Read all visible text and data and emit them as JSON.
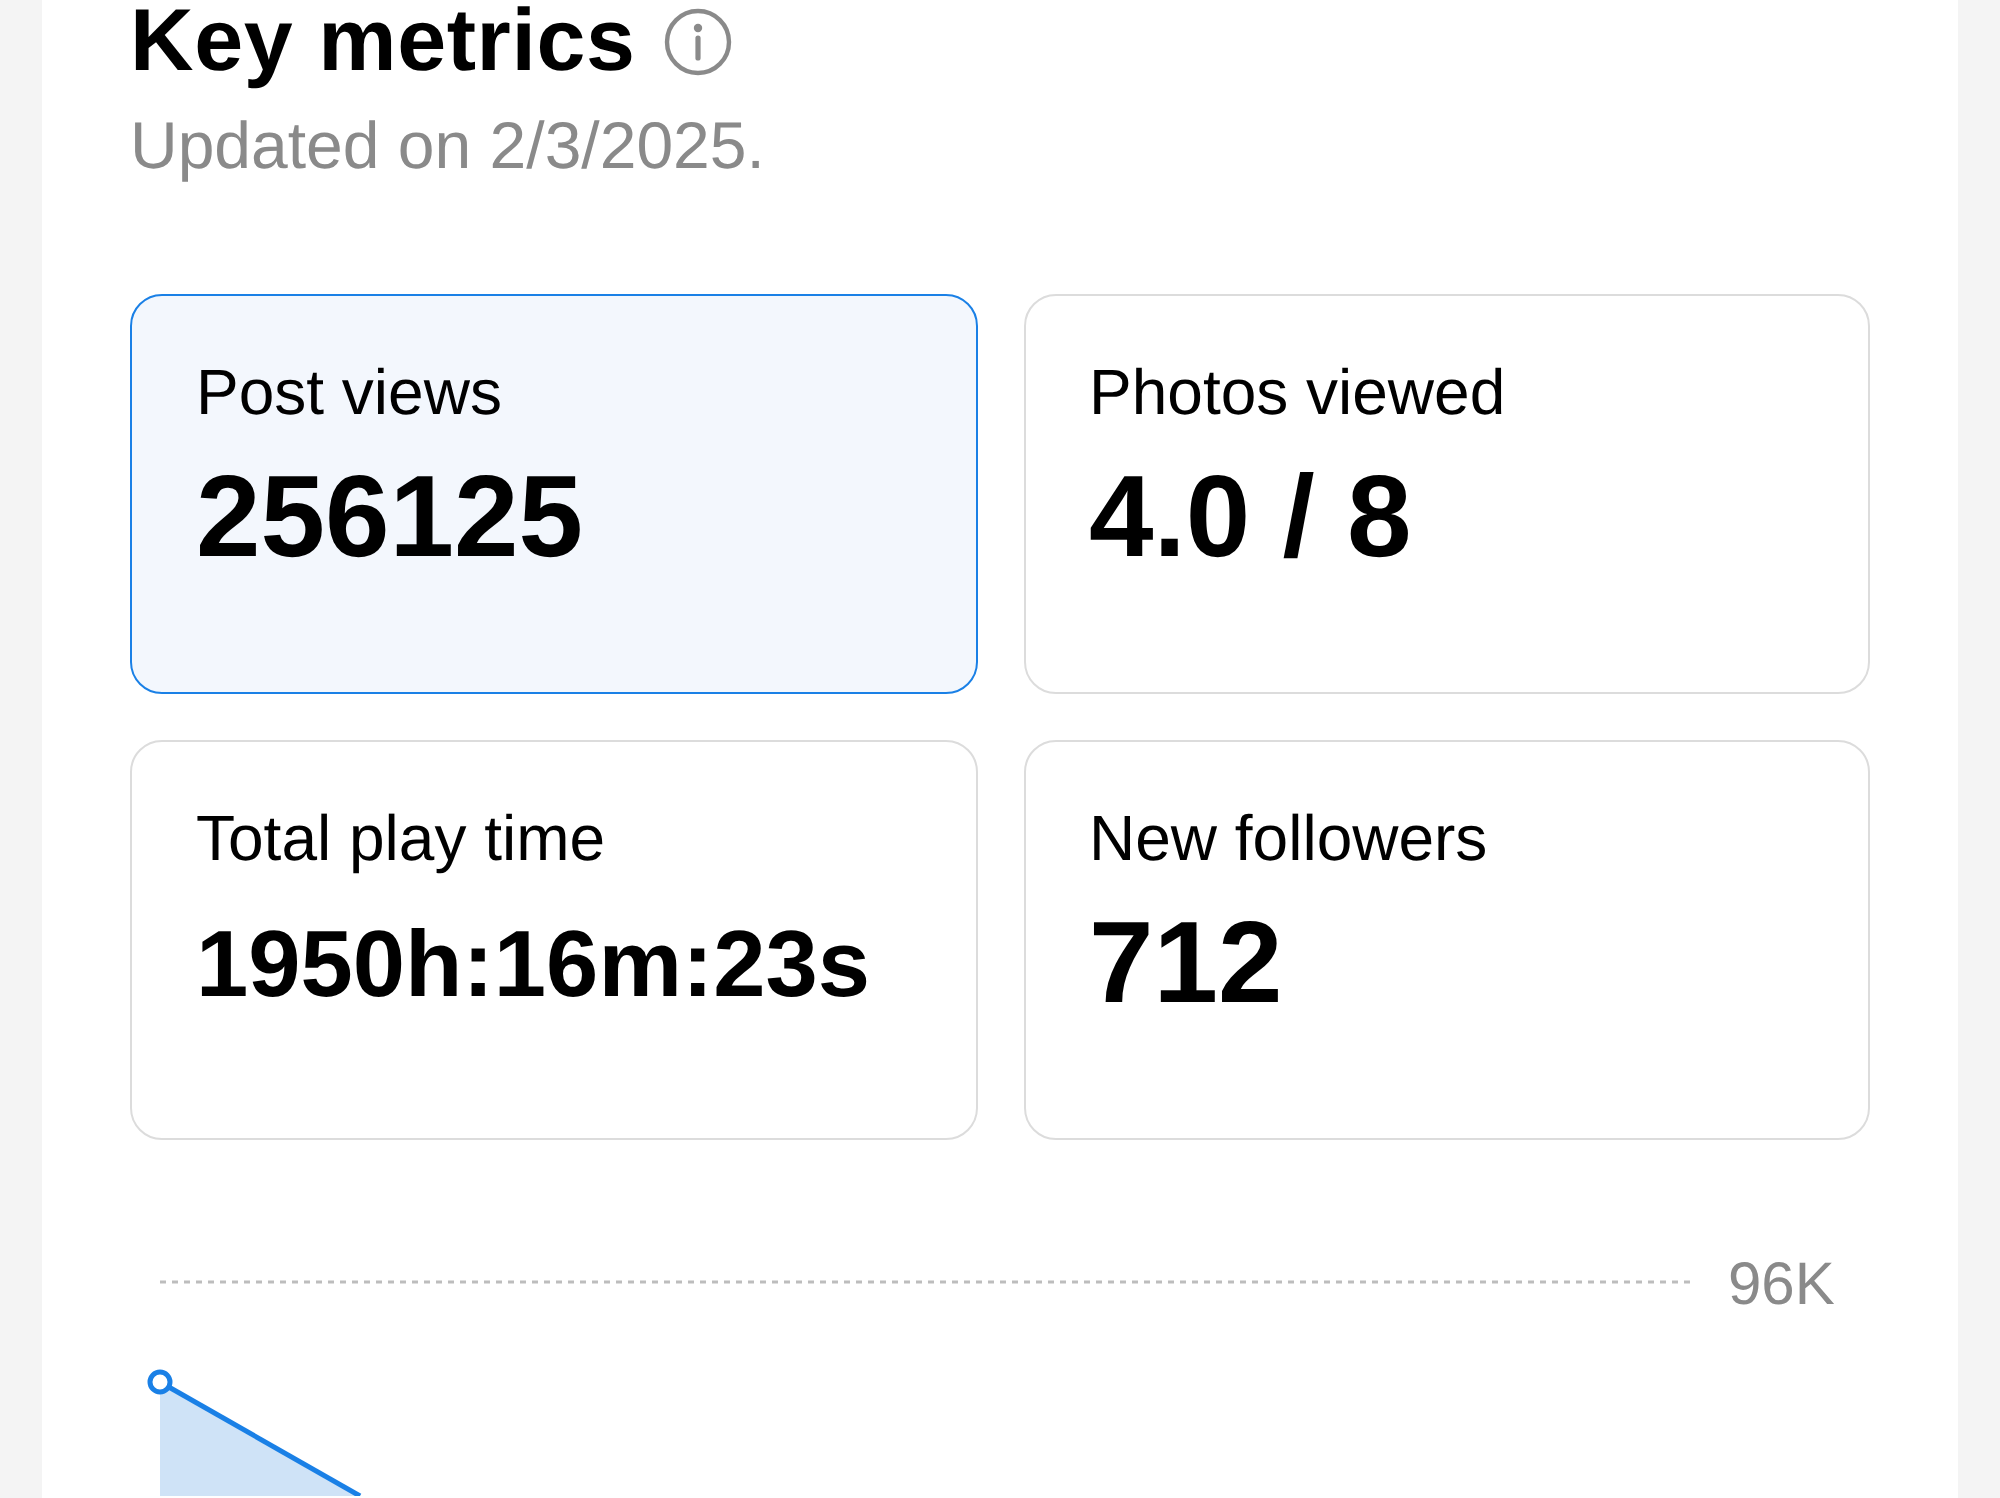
{
  "header": {
    "title": "Key metrics",
    "subtitle": "Updated on 2/3/2025."
  },
  "metrics": [
    {
      "label": "Post views",
      "value": "256125",
      "selected": true
    },
    {
      "label": "Photos viewed",
      "value": "4.0 / 8",
      "selected": false
    },
    {
      "label": "Total play time",
      "value": "1950h:16m:23s",
      "selected": false
    },
    {
      "label": "New followers",
      "value": "712",
      "selected": false
    }
  ],
  "chart": {
    "gridline_label": "96K"
  }
}
